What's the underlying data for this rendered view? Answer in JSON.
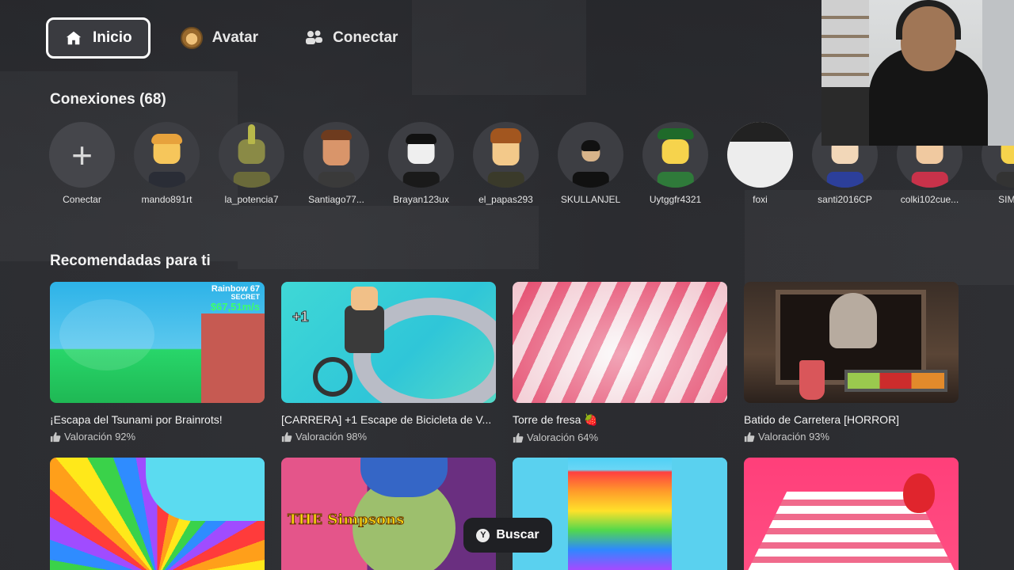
{
  "nav": {
    "items": [
      {
        "label": "Inicio",
        "icon": "home-icon",
        "active": true
      },
      {
        "label": "Avatar",
        "icon": "avatar-icon",
        "active": false
      },
      {
        "label": "Conectar",
        "icon": "people-icon",
        "active": false
      }
    ]
  },
  "connections": {
    "title": "Conexiones (68)",
    "add_label": "Conectar",
    "friends": [
      {
        "name": "mando891rt"
      },
      {
        "name": "la_potencia7"
      },
      {
        "name": "Santiago77..."
      },
      {
        "name": "Brayan123ux"
      },
      {
        "name": "el_papas293"
      },
      {
        "name": "SKULLANJEL"
      },
      {
        "name": "Uytggfr4321"
      },
      {
        "name": "foxi"
      },
      {
        "name": "santi2016CP"
      },
      {
        "name": "colki102cue..."
      },
      {
        "name": "SIMIO_"
      }
    ]
  },
  "recommended": {
    "title": "Recomendadas para ti",
    "games": [
      {
        "title": "¡Escapa del Tsunami por Brainrots!",
        "rating": "Valoración 92%",
        "thumb_text_1": "Rainbow 67",
        "thumb_text_2": "SECRET",
        "thumb_text_3": "$67,51m/s"
      },
      {
        "title": "[CARRERA] +1 Escape de Bicicleta de V...",
        "rating": "Valoración 98%",
        "thumb_text_1": "+1"
      },
      {
        "title": "Torre de fresa 🍓",
        "rating": "Valoración 64%"
      },
      {
        "title": "Batido de Carretera [HORROR]",
        "rating": "Valoración 93%"
      },
      {
        "title": "",
        "rating": ""
      },
      {
        "title": "",
        "rating": "",
        "thumb_text_1": "THE Simpsons"
      },
      {
        "title": "",
        "rating": ""
      },
      {
        "title": "",
        "rating": ""
      }
    ]
  },
  "search": {
    "button_glyph": "Y",
    "label": "Buscar"
  }
}
